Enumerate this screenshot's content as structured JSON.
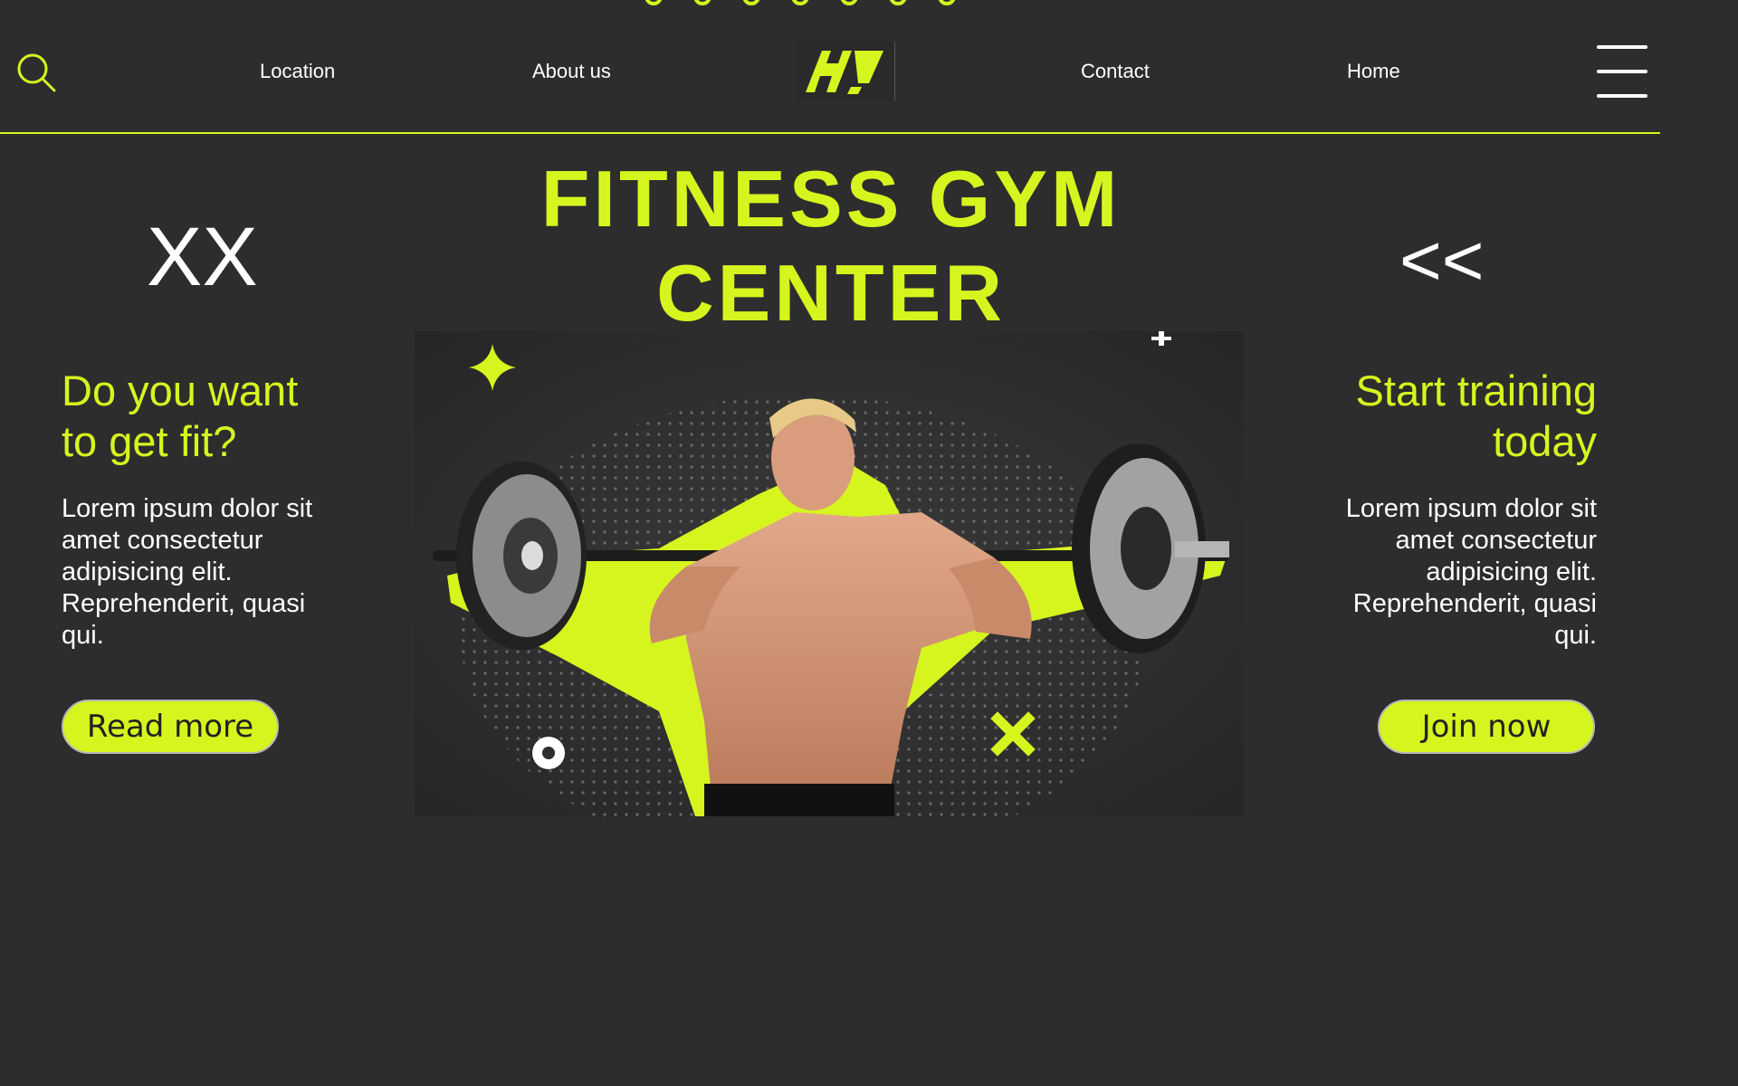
{
  "colors": {
    "accent": "#d6f51f",
    "background": "#2d2d2d",
    "text": "#ffffff"
  },
  "nav": {
    "search_icon": "search-icon",
    "links": [
      "Location",
      "About us",
      "Contact",
      "Home"
    ],
    "logo": "H!",
    "menu_icon": "hamburger-menu-icon"
  },
  "hero": {
    "title_line1": "FITNESS GYM",
    "title_line2": "CENTER",
    "mark_left": "XX",
    "mark_right": "<<"
  },
  "left": {
    "heading_line1": "Do you want",
    "heading_line2": "to get fit?",
    "text": "Lorem ipsum dolor sit amet consectetur adipisicing elit. Reprehenderit, quasi qui.",
    "button": "Read more"
  },
  "right": {
    "heading_line1": "Start training",
    "heading_line2": "today",
    "text": "Lorem ipsum dolor sit amet consectetur adipisicing elit. Reprehenderit, quasi qui.",
    "button": "Join now"
  }
}
